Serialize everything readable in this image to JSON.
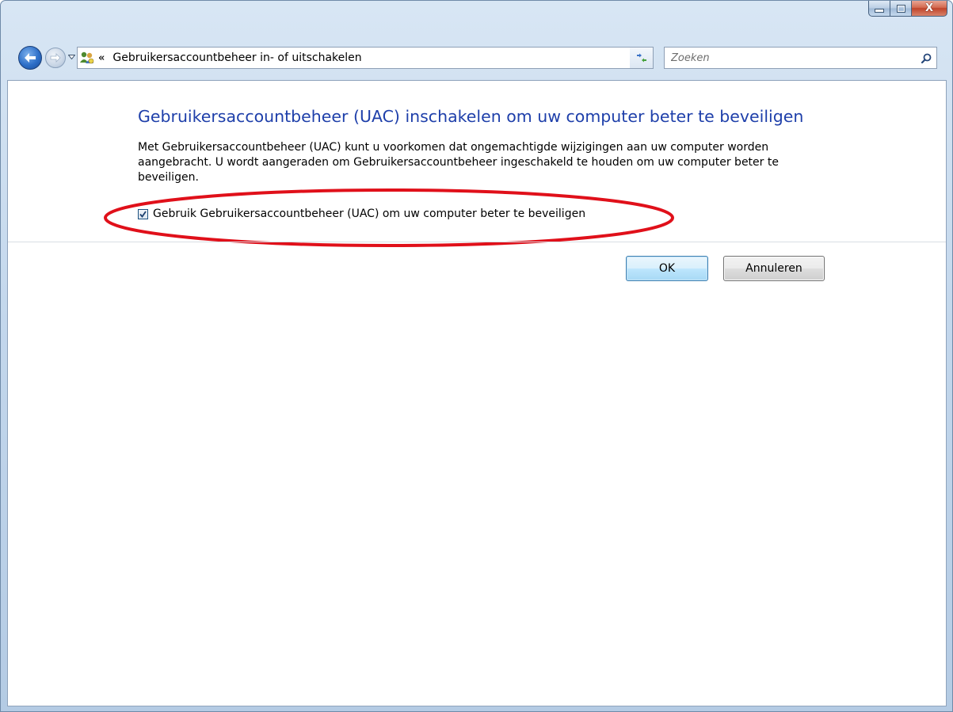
{
  "window": {
    "minimize_label": "minimize",
    "maximize_label": "maximize",
    "close_label": "X"
  },
  "navigation": {
    "breadcrumb_prefix": "«",
    "address": "Gebruikersaccountbeheer in- of uitschakelen",
    "search_placeholder": "Zoeken"
  },
  "main": {
    "title": "Gebruikersaccountbeheer (UAC) inschakelen om uw computer beter te beveiligen",
    "description": "Met Gebruikersaccountbeheer (UAC) kunt u voorkomen dat ongemachtigde wijzigingen aan uw computer worden aangebracht. U wordt aangeraden om Gebruikersaccountbeheer ingeschakeld te houden om uw computer beter te beveiligen.",
    "checkbox_label": "Gebruik Gebruikersaccountbeheer (UAC) om uw computer beter te beveiligen",
    "checkbox_checked": true
  },
  "buttons": {
    "ok": "OK",
    "cancel": "Annuleren"
  },
  "colors": {
    "title": "#1e3faa",
    "highlight": "#e0101a"
  },
  "icons": {
    "back": "back-arrow-icon",
    "forward": "forward-arrow-icon",
    "address": "user-accounts-icon",
    "refresh": "refresh-icon",
    "search": "search-icon"
  }
}
